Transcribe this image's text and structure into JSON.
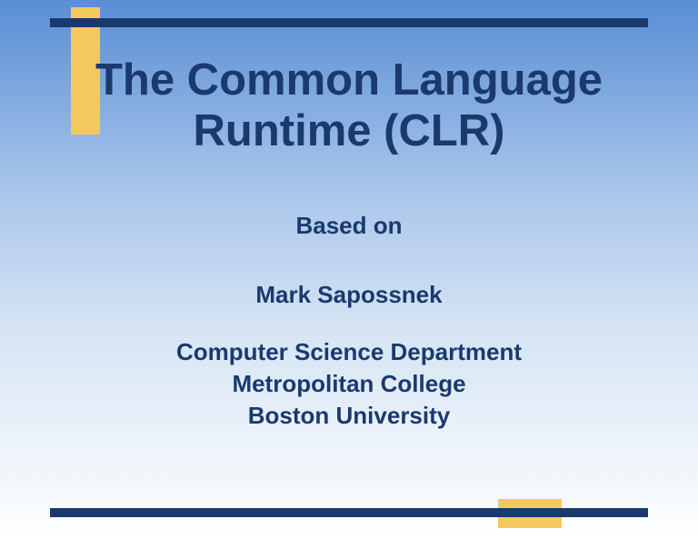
{
  "slide": {
    "title": "The Common Language Runtime (CLR)",
    "basedOn": "Based on",
    "author": "Mark Sapossnek",
    "affiliation1": "Computer Science Department",
    "affiliation2": "Metropolitan College",
    "affiliation3": "Boston University"
  }
}
